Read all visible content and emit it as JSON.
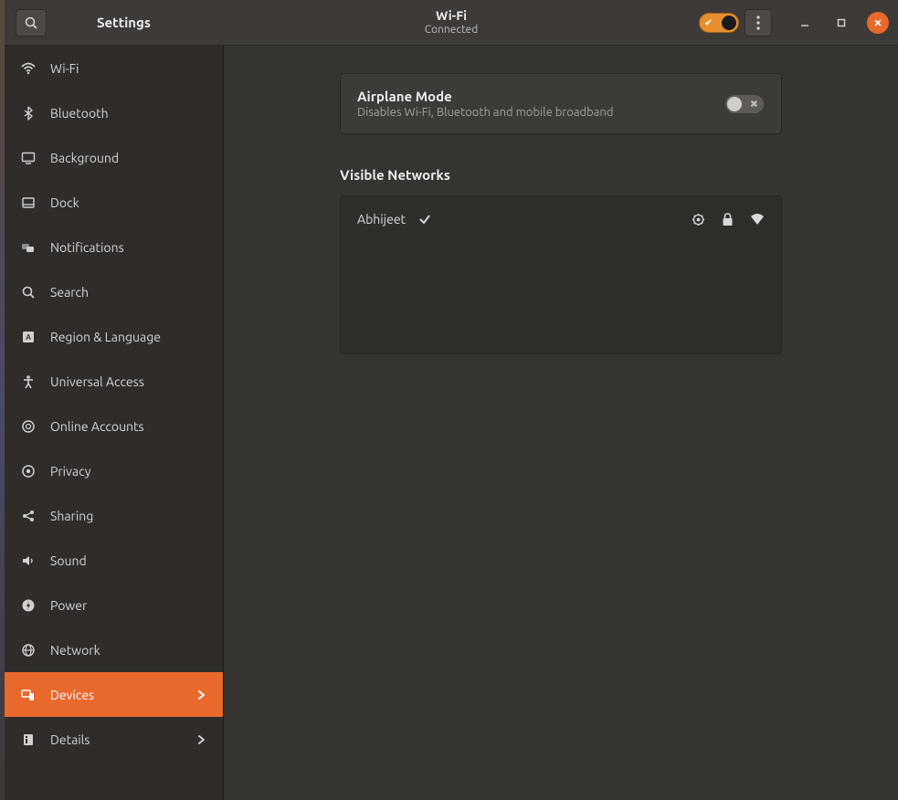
{
  "app_title": "Settings",
  "header": {
    "title": "Wi-Fi",
    "subtitle": "Connected",
    "wifi_enabled": true
  },
  "sidebar": {
    "items": [
      {
        "id": "wifi",
        "label": "Wi-Fi",
        "icon": "wifi",
        "active": false,
        "has_arrow": false
      },
      {
        "id": "bluetooth",
        "label": "Bluetooth",
        "icon": "bluetooth",
        "active": false,
        "has_arrow": false
      },
      {
        "id": "background",
        "label": "Background",
        "icon": "monitor",
        "active": false,
        "has_arrow": false
      },
      {
        "id": "dock",
        "label": "Dock",
        "icon": "dock",
        "active": false,
        "has_arrow": false
      },
      {
        "id": "notifications",
        "label": "Notifications",
        "icon": "bell",
        "active": false,
        "has_arrow": false
      },
      {
        "id": "search",
        "label": "Search",
        "icon": "search",
        "active": false,
        "has_arrow": false
      },
      {
        "id": "region",
        "label": "Region & Language",
        "icon": "region",
        "active": false,
        "has_arrow": false
      },
      {
        "id": "ua",
        "label": "Universal Access",
        "icon": "accessibility",
        "active": false,
        "has_arrow": false
      },
      {
        "id": "online",
        "label": "Online Accounts",
        "icon": "cloud",
        "active": false,
        "has_arrow": false
      },
      {
        "id": "privacy",
        "label": "Privacy",
        "icon": "privacy",
        "active": false,
        "has_arrow": false
      },
      {
        "id": "sharing",
        "label": "Sharing",
        "icon": "share",
        "active": false,
        "has_arrow": false
      },
      {
        "id": "sound",
        "label": "Sound",
        "icon": "sound",
        "active": false,
        "has_arrow": false
      },
      {
        "id": "power",
        "label": "Power",
        "icon": "power",
        "active": false,
        "has_arrow": false
      },
      {
        "id": "network",
        "label": "Network",
        "icon": "globe",
        "active": false,
        "has_arrow": false
      },
      {
        "id": "devices",
        "label": "Devices",
        "icon": "devices",
        "active": true,
        "has_arrow": true
      },
      {
        "id": "details",
        "label": "Details",
        "icon": "info",
        "active": false,
        "has_arrow": true
      }
    ]
  },
  "airplane": {
    "title": "Airplane Mode",
    "description": "Disables Wi-Fi, Bluetooth and mobile broadband",
    "enabled": false
  },
  "networks": {
    "header": "Visible Networks",
    "list": [
      {
        "name": "Abhijeet",
        "connected": true,
        "secured": true,
        "strength": "full"
      }
    ]
  }
}
